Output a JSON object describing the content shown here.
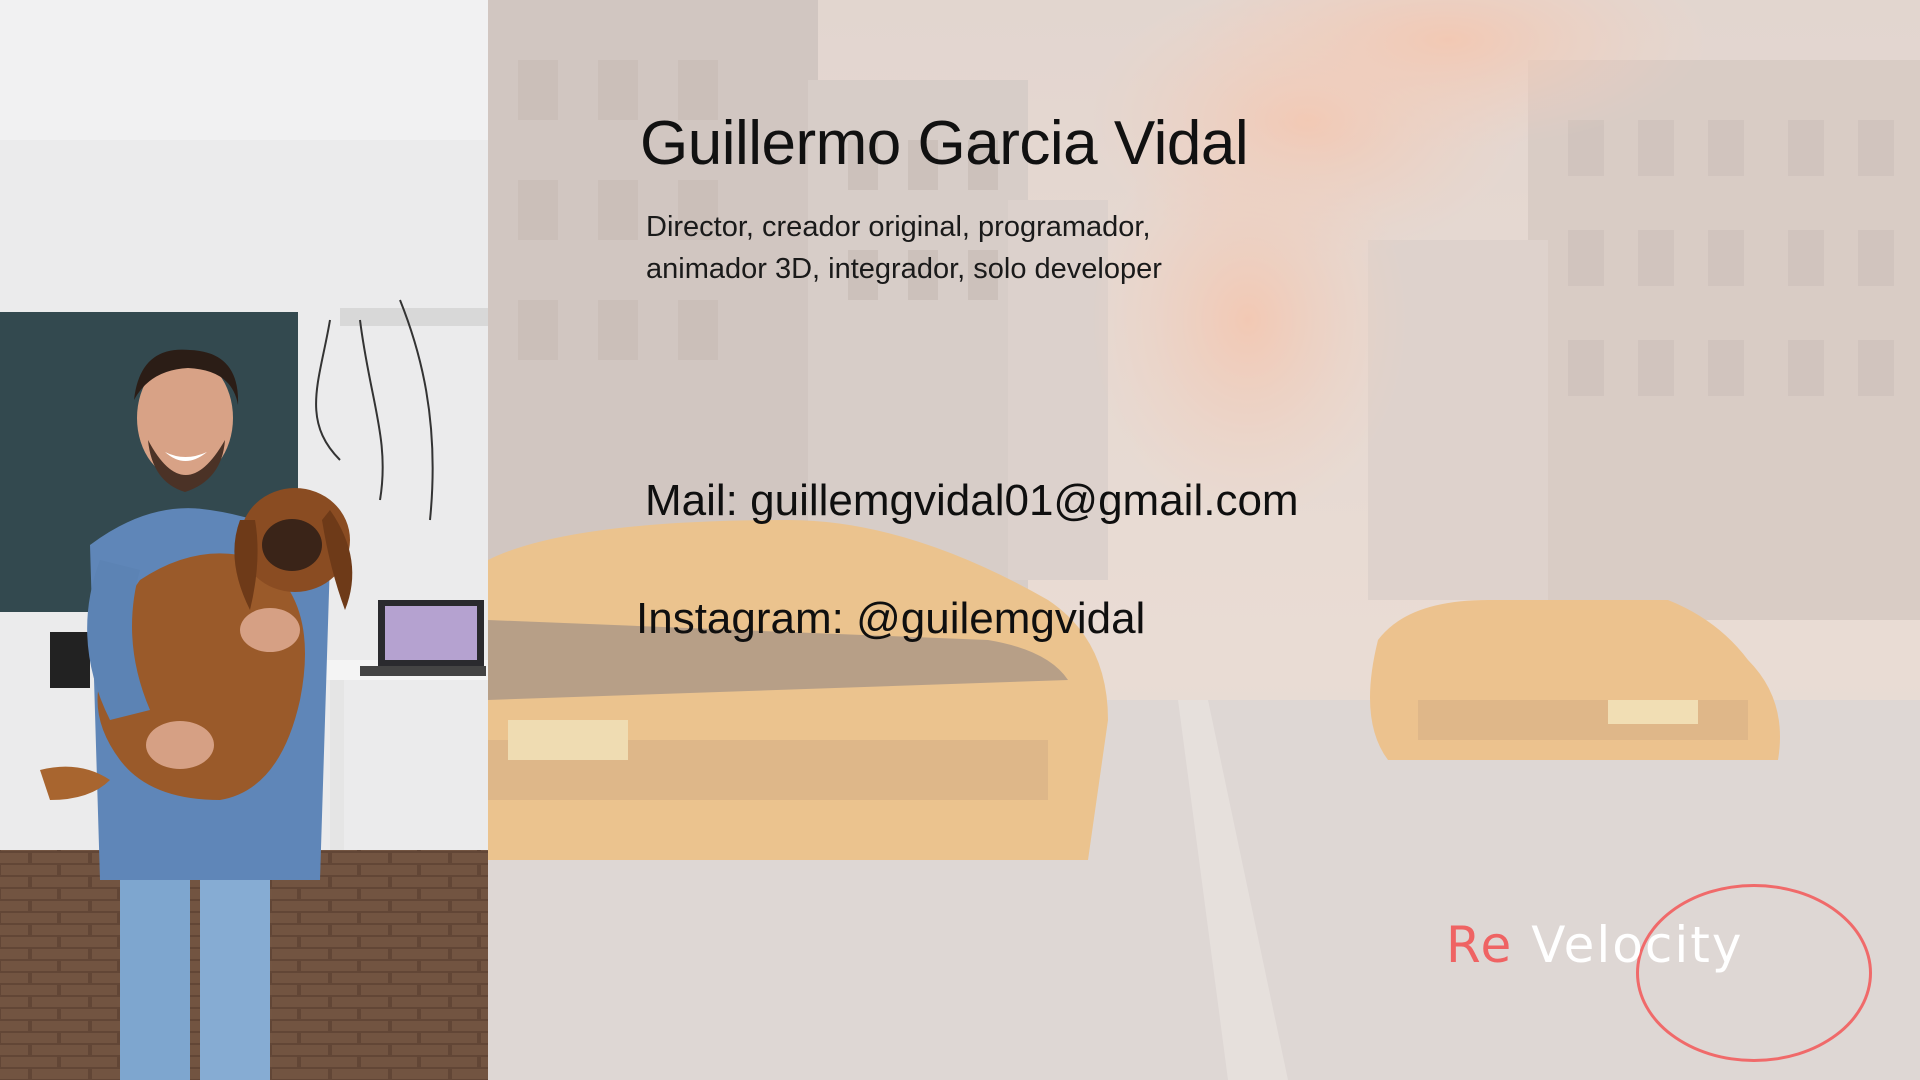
{
  "profile": {
    "name": "Guillermo Garcia Vidal",
    "roles": "Director, creador original, programador,\nanimador 3D, integrador, solo developer",
    "mail": "Mail: guillemgvidal01@gmail.com",
    "instagram": "Instagram: @guilemgvidal"
  },
  "logo": {
    "prefix": "Re",
    "word": "Velocity",
    "accent_color": "#ef6363"
  }
}
